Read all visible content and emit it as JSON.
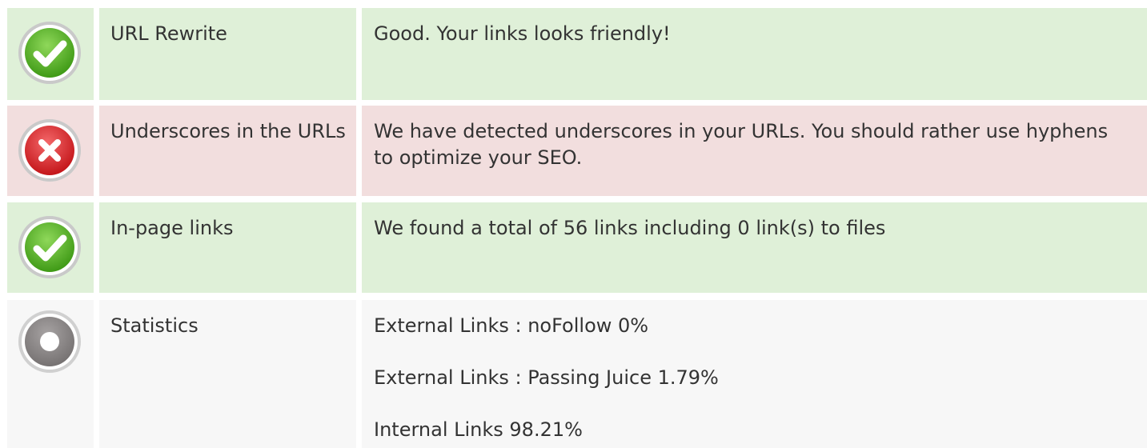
{
  "rows": [
    {
      "status": "good",
      "icon": "check-circle-icon",
      "label": "URL Rewrite",
      "description": "Good. Your links looks friendly!"
    },
    {
      "status": "bad",
      "icon": "error-x-circle-icon",
      "label": "Underscores in the URLs",
      "description": "We have detected underscores in your URLs. You should rather use hyphens to optimize your SEO."
    },
    {
      "status": "good",
      "icon": "check-circle-icon",
      "label": "In-page links",
      "description": "We found a total of 56 links including 0 link(s) to files"
    },
    {
      "status": "neutral",
      "icon": "info-circle-icon",
      "label": "Statistics",
      "stats": [
        "External Links : noFollow 0%",
        "External Links : Passing Juice 1.79%",
        "Internal Links 98.21%"
      ]
    }
  ],
  "colors": {
    "good_bg": "#dff0d8",
    "bad_bg": "#f2dede",
    "neutral_bg": "#f7f7f7",
    "check_green": "#5cb52a",
    "error_red": "#e0282c",
    "neutral_gray": "#8f8b8b"
  }
}
